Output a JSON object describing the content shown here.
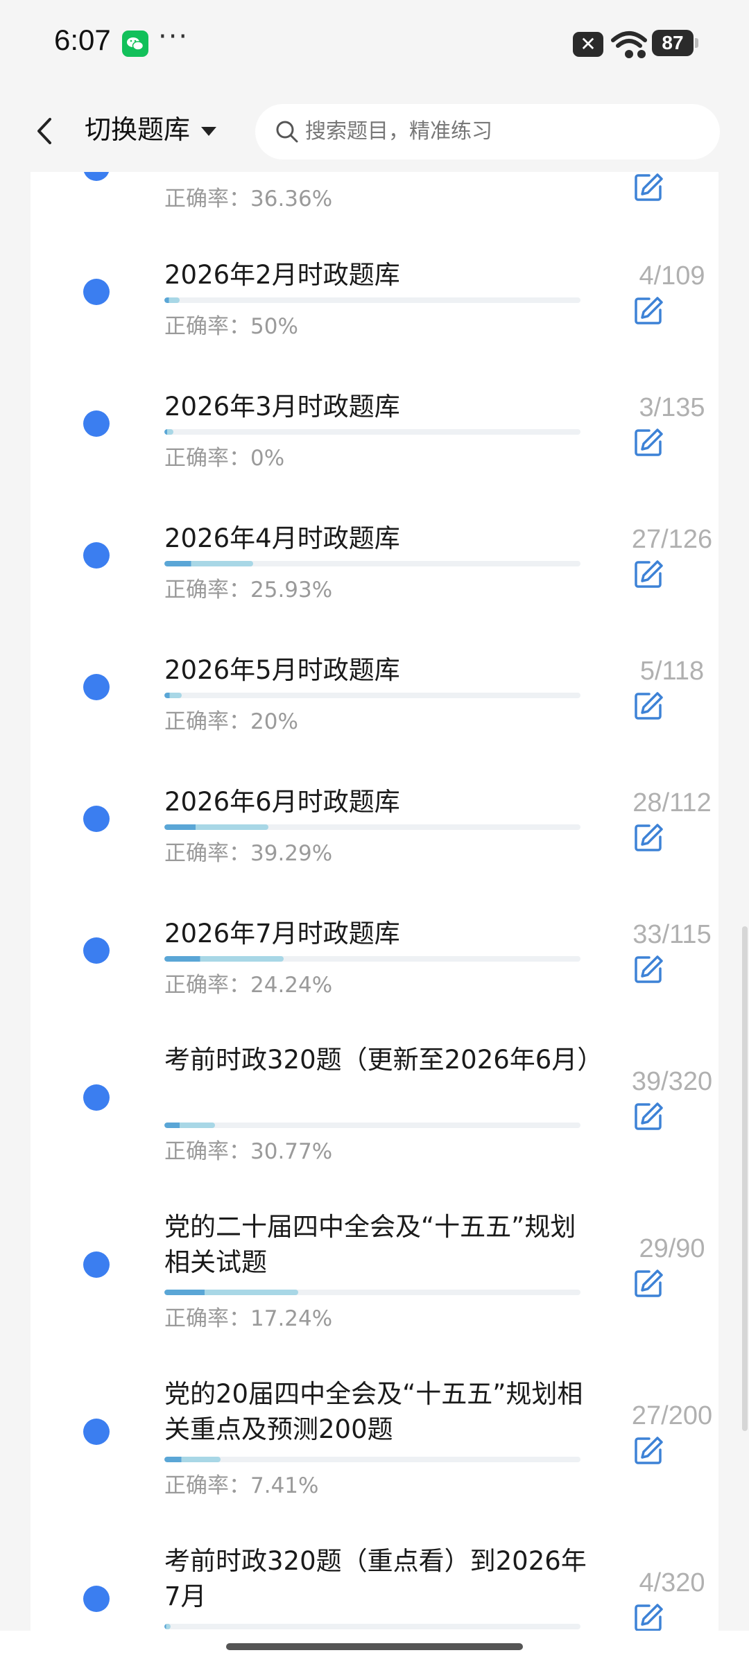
{
  "status_bar": {
    "time": "6:07",
    "more": "···",
    "battery": "87",
    "icons": [
      "wechat-icon",
      "close-notification-icon",
      "wifi-icon",
      "battery-icon"
    ]
  },
  "header": {
    "back_icon": "chevron-left-icon",
    "switch_label": "切换题库",
    "search_placeholder": "搜索题目，精准练习"
  },
  "colors": {
    "dot": "#3b7ef0",
    "edit_icon": "#3d82d6",
    "progress_dark": "#5aa6d6",
    "progress_light": "#a8d7e6",
    "text_muted": "#9a9a9a"
  },
  "top_partial": {
    "accuracy": "正确率：36.36%"
  },
  "items": [
    {
      "title": "2026年2月时政题库",
      "count": "4/109",
      "accuracy": "正确率：50%",
      "progress": 0.037
    },
    {
      "title": "2026年3月时政题库",
      "count": "3/135",
      "accuracy": "正确率：0%",
      "progress": 0.022
    },
    {
      "title": "2026年4月时政题库",
      "count": "27/126",
      "accuracy": "正确率：25.93%",
      "progress": 0.214
    },
    {
      "title": "2026年5月时政题库",
      "count": "5/118",
      "accuracy": "正确率：20%",
      "progress": 0.042
    },
    {
      "title": "2026年6月时政题库",
      "count": "28/112",
      "accuracy": "正确率：39.29%",
      "progress": 0.25
    },
    {
      "title": "2026年7月时政题库",
      "count": "33/115",
      "accuracy": "正确率：24.24%",
      "progress": 0.287
    },
    {
      "title": "考前时政320题（更新至2026年6月）",
      "count": "39/320",
      "accuracy": "正确率：30.77%",
      "progress": 0.122
    },
    {
      "title": "党的二十届四中全会及“十五五”规划相关试题",
      "count": "29/90",
      "accuracy": "正确率：17.24%",
      "progress": 0.322
    },
    {
      "title": "党的20届四中全会及“十五五”规划相关重点及预测200题",
      "count": "27/200",
      "accuracy": "正确率：7.41%",
      "progress": 0.135
    },
    {
      "title": "考前时政320题（重点看）到2026年7月",
      "count": "4/320",
      "accuracy": "",
      "progress": 0.0125
    }
  ]
}
